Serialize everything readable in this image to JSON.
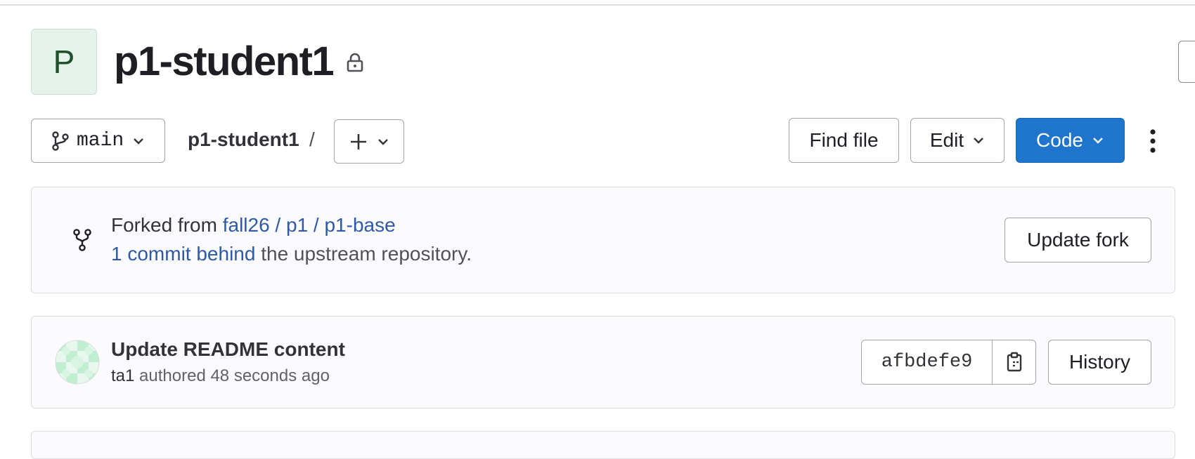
{
  "project": {
    "avatar_letter": "P",
    "name": "p1-student1",
    "visibility_icon": "lock-icon"
  },
  "toolbar": {
    "branch_icon": "branch-icon",
    "branch": "main",
    "breadcrumb_project": "p1-student1",
    "breadcrumb_separator": "/",
    "add_icon": "plus-icon",
    "find_file_label": "Find file",
    "edit_label": "Edit",
    "code_label": "Code",
    "more_icon": "kebab-icon"
  },
  "fork": {
    "icon": "fork-icon",
    "forked_from_label": "Forked from",
    "source": "fall26 / p1 / p1-base",
    "behind_link": "1 commit behind",
    "behind_suffix": "the upstream repository.",
    "update_button": "Update fork"
  },
  "commit": {
    "title": "Update README content",
    "author": "ta1",
    "meta_text": "authored 48 seconds ago",
    "sha": "afbdefe9",
    "copy_icon": "copy-icon",
    "history_label": "History"
  },
  "colors": {
    "accent": "#1f75cb",
    "link": "#2f5aa3",
    "avatar_bg": "#e6f3ea"
  }
}
